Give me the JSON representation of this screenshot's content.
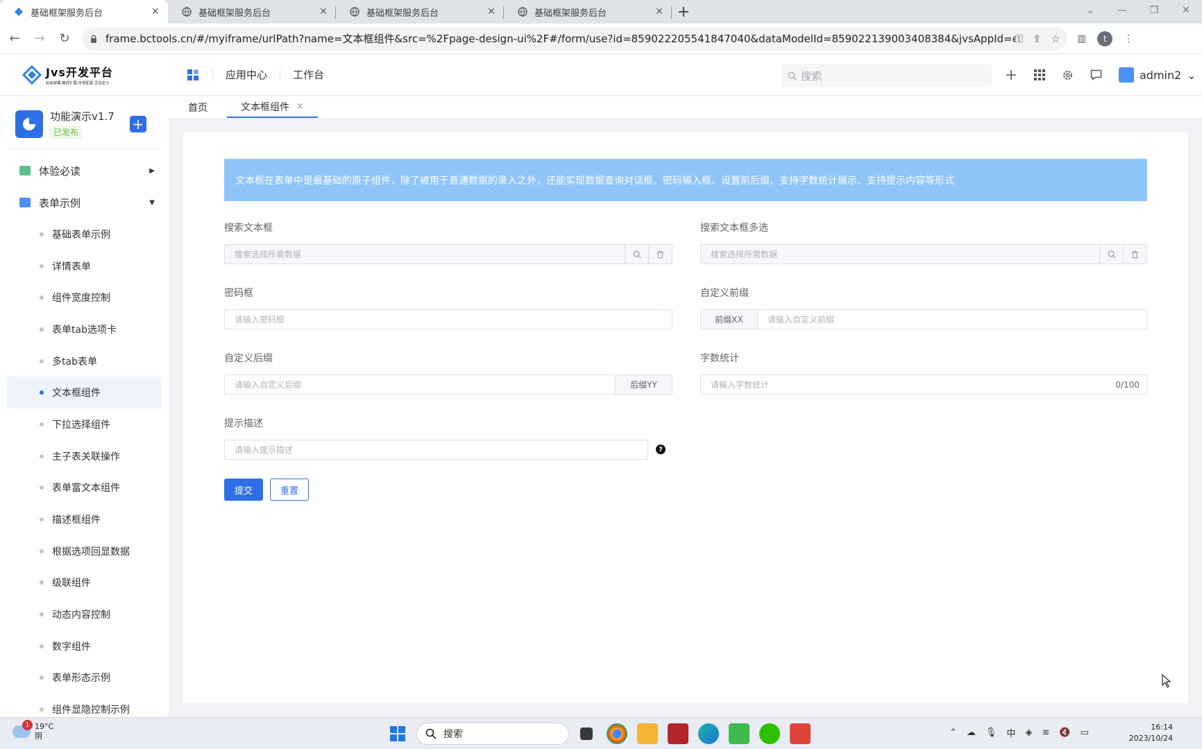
{
  "browser": {
    "tabs": [
      {
        "title": "基础框架服务后台",
        "active": true
      },
      {
        "title": "基础框架服务后台",
        "active": false
      },
      {
        "title": "基础框架服务后台",
        "active": false
      },
      {
        "title": "基础框架服务后台",
        "active": false
      }
    ],
    "url": "frame.bctools.cn/#/myiframe/urlPath?name=文本框组件&src=%2Fpage-design-ui%2F#/form/use?id=859022205541847040&dataModelId=859022139003408384&jvsAppId=edaf8fb499f524e7a5fafc81...",
    "profile_initial": "t"
  },
  "header": {
    "logo_title": "Jvs开发平台",
    "logo_subtitle": "私有部署,集成扩展,可视配置,灵活定义",
    "nav": [
      "应用中心",
      "工作台"
    ],
    "search_placeholder": "搜索",
    "username": "admin2"
  },
  "sidebar": {
    "app_name": "功能演示v1.7",
    "app_status": "已发布",
    "groups": [
      {
        "label": "体验必读",
        "expanded": false,
        "color": "#5cc08e"
      },
      {
        "label": "表单示例",
        "expanded": true,
        "color": "#4a90f5"
      }
    ],
    "items": [
      {
        "label": "基础表单示例",
        "active": false
      },
      {
        "label": "详情表单",
        "active": false
      },
      {
        "label": "组件宽度控制",
        "active": false
      },
      {
        "label": "表单tab选项卡",
        "active": false
      },
      {
        "label": "多tab表单",
        "active": false
      },
      {
        "label": "文本框组件",
        "active": true
      },
      {
        "label": "下拉选择组件",
        "active": false
      },
      {
        "label": "主子表关联操作",
        "active": false
      },
      {
        "label": "表单富文本组件",
        "active": false
      },
      {
        "label": "描述框组件",
        "active": false
      },
      {
        "label": "根据选项回显数据",
        "active": false
      },
      {
        "label": "级联组件",
        "active": false
      },
      {
        "label": "动态内容控制",
        "active": false
      },
      {
        "label": "数字组件",
        "active": false
      },
      {
        "label": "表单形态示例",
        "active": false
      },
      {
        "label": "组件显隐控制示例",
        "active": false
      }
    ]
  },
  "page_tabs": [
    {
      "label": "首页",
      "active": false
    },
    {
      "label": "文本框组件",
      "active": true,
      "close": "×"
    }
  ],
  "form": {
    "notice": "文本框在表单中是最基础的原子组件，除了被用于普通数据的录入之外，还能实现数据查询对话框、密码输入框、设置前后缀、支持字数统计展示、支持提示内容等形式",
    "search_text": {
      "label": "搜索文本框",
      "placeholder": "搜索选择所需数据"
    },
    "search_multi": {
      "label": "搜索文本框多选",
      "placeholder": "搜索选择所需数据"
    },
    "password": {
      "label": "密码框",
      "placeholder": "请输入密码框"
    },
    "prefix": {
      "label": "自定义前缀",
      "prefix": "前缀XX",
      "placeholder": "请输入自定义前缀"
    },
    "suffix": {
      "label": "自定义后缀",
      "suffix": "后缀YY",
      "placeholder": "请输入自定义后缀"
    },
    "wordcount": {
      "label": "字数统计",
      "placeholder": "请输入字数统计",
      "count": "0/100"
    },
    "hint": {
      "label": "提示描述",
      "placeholder": "请输入提示描述",
      "help": "?"
    },
    "submit_label": "提交",
    "reset_label": "重置"
  },
  "taskbar": {
    "notification_count": "1",
    "temperature": "19°C",
    "weather": "阴",
    "search_label": "搜索",
    "ime": "中",
    "time": "16:14",
    "date": "2023/10/24"
  }
}
